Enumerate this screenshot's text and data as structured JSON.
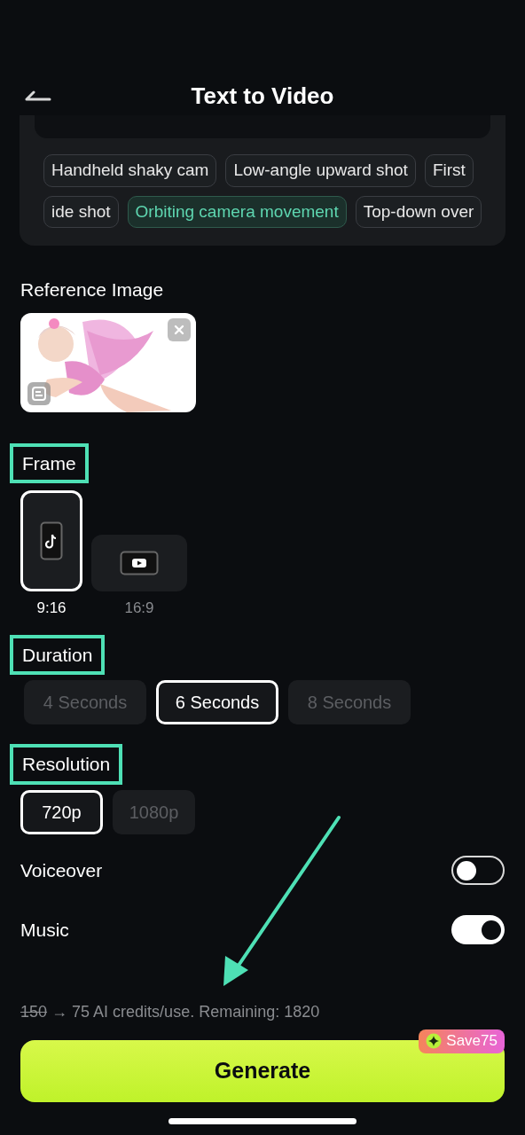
{
  "header": {
    "title": "Text to Video"
  },
  "style_chips": [
    [
      {
        "label": "Handheld shaky cam",
        "selected": false
      },
      {
        "label": "Low-angle upward shot",
        "selected": false
      },
      {
        "label": "First",
        "selected": false
      }
    ],
    [
      {
        "label": "ide shot",
        "selected": false
      },
      {
        "label": "Orbiting camera movement",
        "selected": true
      },
      {
        "label": "Top-down over",
        "selected": false
      }
    ]
  ],
  "reference_image": {
    "label": "Reference Image"
  },
  "frame": {
    "label": "Frame",
    "highlighted": true,
    "options": [
      {
        "label": "9:16",
        "kind": "portrait",
        "selected": true
      },
      {
        "label": "16:9",
        "kind": "landscape",
        "selected": false
      }
    ]
  },
  "duration": {
    "label": "Duration",
    "highlighted": true,
    "options": [
      {
        "label": "4 Seconds",
        "selected": false
      },
      {
        "label": "6 Seconds",
        "selected": true
      },
      {
        "label": "8 Seconds",
        "selected": false
      }
    ]
  },
  "resolution": {
    "label": "Resolution",
    "highlighted": true,
    "options": [
      {
        "label": "720p",
        "selected": true
      },
      {
        "label": "1080p",
        "selected": false
      }
    ]
  },
  "toggles": [
    {
      "label": "Voiceover",
      "on": false
    },
    {
      "label": "Music",
      "on": true
    }
  ],
  "credits": {
    "old": "150",
    "rest": "→ 75 AI credits/use. Remaining: 1820"
  },
  "generate": {
    "label": "Generate",
    "badge": "Save75"
  }
}
